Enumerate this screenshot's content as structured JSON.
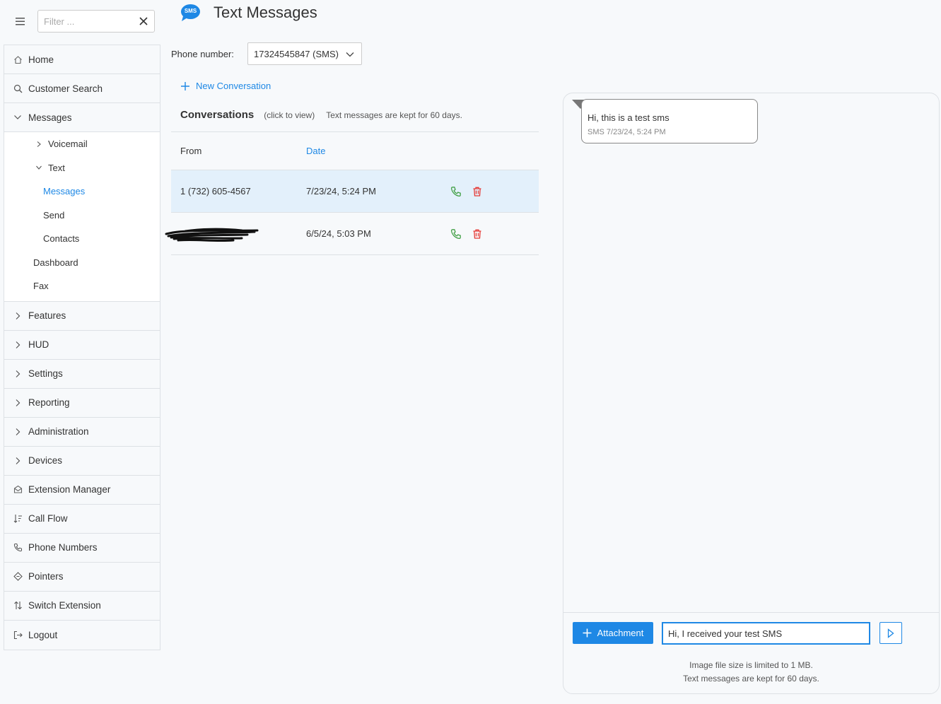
{
  "topbar": {
    "filter_placeholder": "Filter ..."
  },
  "sidebar": {
    "items": [
      {
        "label": "Home",
        "icon": "home-icon"
      },
      {
        "label": "Customer Search",
        "icon": "search-icon"
      },
      {
        "label": "Messages",
        "icon": "chevron-down-icon"
      },
      {
        "label": "Features",
        "icon": "chevron-right-icon"
      },
      {
        "label": "HUD",
        "icon": "chevron-right-icon"
      },
      {
        "label": "Settings",
        "icon": "chevron-right-icon"
      },
      {
        "label": "Reporting",
        "icon": "chevron-right-icon"
      },
      {
        "label": "Administration",
        "icon": "chevron-right-icon"
      },
      {
        "label": "Devices",
        "icon": "chevron-right-icon"
      },
      {
        "label": "Extension Manager",
        "icon": "envelope-icon"
      },
      {
        "label": "Call Flow",
        "icon": "sort-icon"
      },
      {
        "label": "Phone Numbers",
        "icon": "phone-icon"
      },
      {
        "label": "Pointers",
        "icon": "diamond-icon"
      },
      {
        "label": "Switch Extension",
        "icon": "swap-icon"
      },
      {
        "label": "Logout",
        "icon": "logout-icon"
      }
    ],
    "messages_sub": {
      "voicemail": "Voicemail",
      "text": "Text",
      "text_messages": "Messages",
      "send": "Send",
      "contacts": "Contacts",
      "dashboard": "Dashboard",
      "fax": "Fax"
    }
  },
  "header": {
    "logo_text": "SMS",
    "title": "Text Messages"
  },
  "phone": {
    "label": "Phone number:",
    "selected": "17324545847 (SMS)"
  },
  "new_conversation_label": "New Conversation",
  "conversations": {
    "title": "Conversations",
    "hint": "(click to view)",
    "retention": "Text messages are kept for 60 days.",
    "columns": {
      "from": "From",
      "date": "Date"
    },
    "rows": [
      {
        "from": "1 (732) 605-4567",
        "date": "7/23/24, 5:24 PM"
      },
      {
        "from": "",
        "date": "6/5/24, 5:03 PM"
      }
    ]
  },
  "chat": {
    "message_text": "Hi, this is a test sms",
    "message_meta": "SMS 7/23/24, 5:24 PM",
    "attachment_label": "Attachment",
    "input_value": "Hi, I received your test SMS",
    "note_size": "Image file size is limited to 1 MB.",
    "note_retention": "Text messages are kept for 60 days."
  },
  "colors": {
    "accent": "#1e88e5",
    "call_green": "#43a047",
    "delete_red": "#e53935",
    "selected_row": "#e3f0fb"
  }
}
